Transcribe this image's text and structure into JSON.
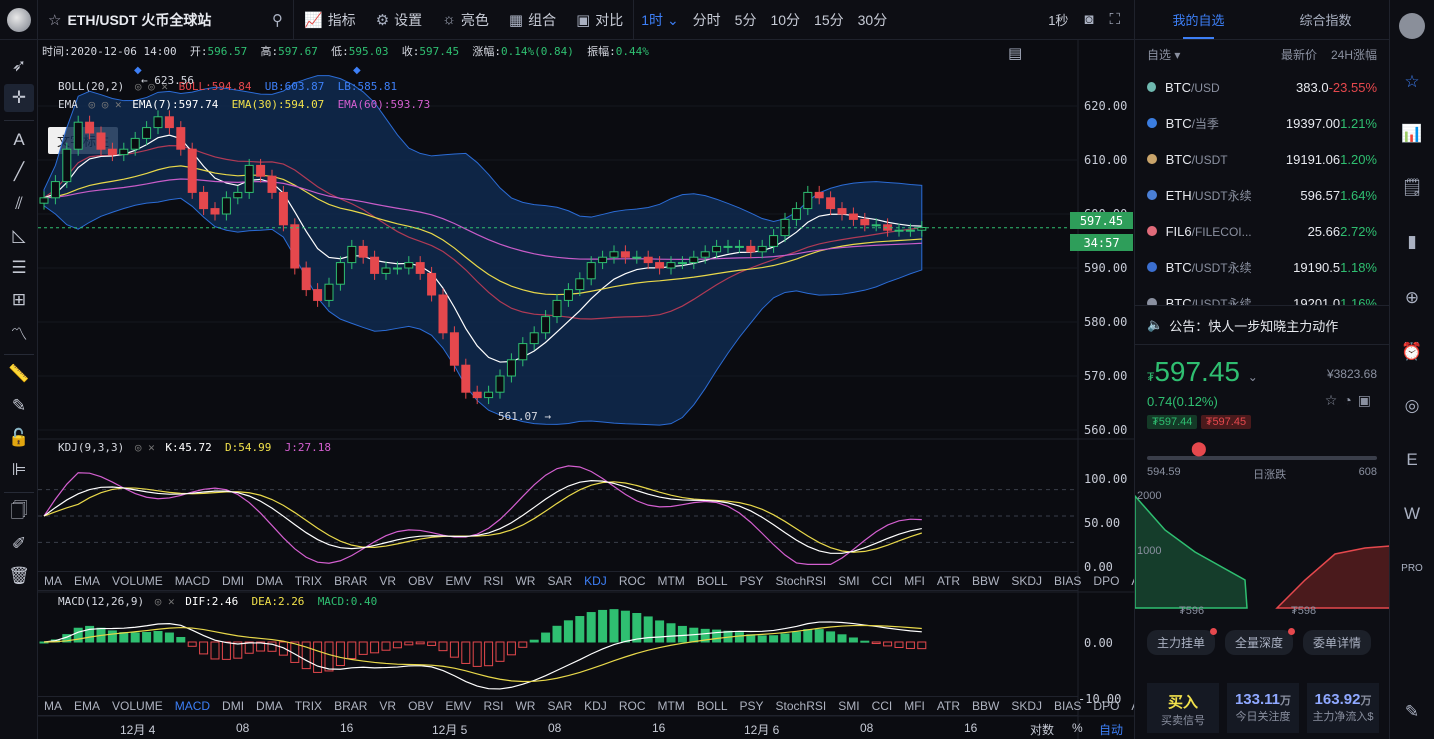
{
  "topbar": {
    "symbol": "ETH/USDT 火币全球站",
    "indicators_label": "指标",
    "settings_label": "设置",
    "theme_label": "亮色",
    "combo_label": "组合",
    "compare_label": "对比",
    "intervals": [
      "1时",
      "分时",
      "5分",
      "10分",
      "15分",
      "30分"
    ],
    "active_interval": "1时",
    "refresh": "1秒"
  },
  "lefttools": {
    "tooltip": "文字标注"
  },
  "chart": {
    "info": {
      "time_label": "时间:",
      "time": "2020-12-06 14:00",
      "open_label": "开:",
      "open": "596.57",
      "high_label": "高:",
      "high": "597.67",
      "low_label": "低:",
      "low": "595.03",
      "close_label": "收:",
      "close": "597.45",
      "change_label": "涨幅:",
      "change": "0.14%(0.84)",
      "amp_label": "振幅:",
      "amp": "0.44%"
    },
    "boll": {
      "name": "BOLL(20,2)",
      "boll": "BOLL:594.84",
      "ub": "UB:603.87",
      "lb": "LB:585.81"
    },
    "ema": {
      "name": "EMA",
      "ema7": "EMA(7):597.74",
      "ema30": "EMA(30):594.07",
      "ema60": "EMA(60):593.73"
    },
    "max_label": "623.56",
    "min_label": "561.07",
    "price_axis": [
      "620.00",
      "610.00",
      "600.00",
      "590.00",
      "580.00",
      "570.00",
      "560.00"
    ],
    "last_price": "597.45",
    "countdown": "34:57",
    "kdj": {
      "name": "KDJ(9,3,3)",
      "k": "K:45.72",
      "d": "D:54.99",
      "j": "J:27.18",
      "axis": [
        "100.00",
        "50.00",
        "0.00"
      ]
    },
    "macd": {
      "name": "MACD(12,26,9)",
      "dif": "DIF:2.46",
      "dea": "DEA:2.26",
      "macd": "MACD:0.40",
      "axis": [
        "0.00",
        "-10.00"
      ]
    },
    "indicator_tabs": [
      "MA",
      "EMA",
      "VOLUME",
      "MACD",
      "DMI",
      "DMA",
      "TRIX",
      "BRAR",
      "VR",
      "OBV",
      "EMV",
      "RSI",
      "WR",
      "SAR",
      "KDJ",
      "ROC",
      "MTM",
      "BOLL",
      "PSY",
      "StochRSI",
      "SMI",
      "CCI",
      "MFI",
      "ATR",
      "BBW",
      "SKDJ",
      "BIAS",
      "DPO",
      "AO"
    ],
    "time_axis": [
      "12月 4",
      "08",
      "16",
      "12月 5",
      "08",
      "16",
      "12月 6",
      "08",
      "16"
    ],
    "bottom_right": {
      "log": "对数",
      "pct": "%",
      "auto": "自动"
    }
  },
  "right": {
    "tab_watchlist": "我的自选",
    "tab_index": "综合指数",
    "head_left": "自选",
    "head_price": "最新价",
    "head_change": "24H涨幅",
    "watchlist": [
      {
        "base": "BTC",
        "quote": "/USD",
        "price": "383.0",
        "change": "-23.55%",
        "dir": "dn",
        "color": "#6fb9b0"
      },
      {
        "base": "BTC",
        "quote": "/当季",
        "price": "19397.00",
        "change": "1.21%",
        "dir": "up",
        "color": "#3b7de0"
      },
      {
        "base": "BTC",
        "quote": "/USDT",
        "price": "19191.06",
        "change": "1.20%",
        "dir": "up",
        "color": "#c9a46b"
      },
      {
        "base": "ETH",
        "quote": "/USDT永续",
        "price": "596.57",
        "change": "1.64%",
        "dir": "up",
        "color": "#4a7fd6"
      },
      {
        "base": "FIL6",
        "quote": "/FILECOI...",
        "price": "25.66",
        "change": "2.72%",
        "dir": "up",
        "color": "#e06b7a",
        "price_dir": "dn"
      },
      {
        "base": "BTC",
        "quote": "/USDT永续",
        "price": "19190.5",
        "change": "1.18%",
        "dir": "up",
        "color": "#3b6fd0"
      },
      {
        "base": "BTC",
        "quote": "/USDT永续",
        "price": "19201.0",
        "change": "1.16%",
        "dir": "up",
        "color": "#8a90a0"
      }
    ],
    "notice": "公告：快人一步知晓主力动作",
    "price": "597.45",
    "price_prefix": "₮",
    "cny": "¥3823.68",
    "change": "0.74(0.12%)",
    "bid_tag": "₮597.44",
    "ask_tag": "₮597.45",
    "range_low": "594.59",
    "range_label": "日涨跌",
    "range_high": "608",
    "depth_y1": "2000",
    "depth_y2": "1000",
    "depth_x1": "₮596",
    "depth_x2": "₮598",
    "btn_main": "主力挂单",
    "btn_depth": "全量深度",
    "btn_order": "委单详情",
    "stat1_val": "买入",
    "stat1_lbl": "买卖信号",
    "stat2_val": "133.11",
    "stat2_unit": "万",
    "stat2_lbl": "今日关注度",
    "stat3_val": "163.92",
    "stat3_unit": "万",
    "stat3_lbl": "主力净流入$"
  }
}
